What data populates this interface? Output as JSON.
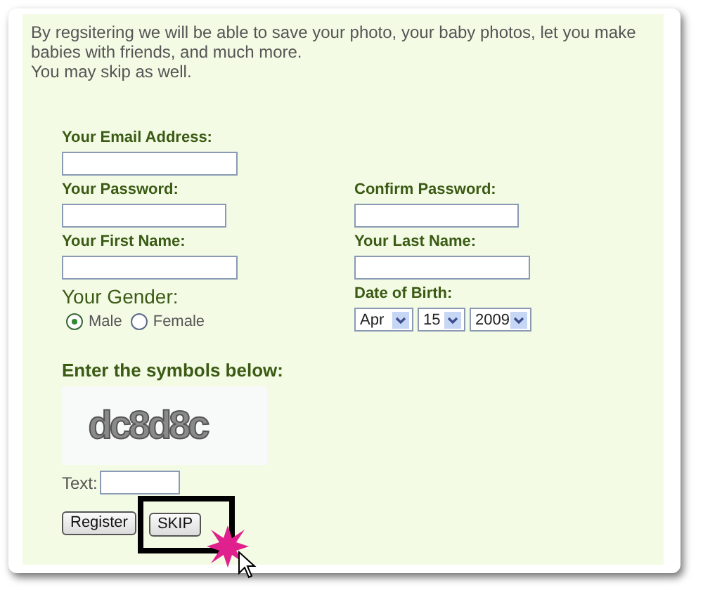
{
  "intro": [
    "By regsitering we will be able to save your photo, your baby photos, let you make babies with friends, and much more.",
    "You may skip as well."
  ],
  "email": {
    "label": "Your Email Address:"
  },
  "password": {
    "label": "Your Password:"
  },
  "confirm_password": {
    "label": "Confirm Password:"
  },
  "first_name": {
    "label": "Your First Name:"
  },
  "last_name": {
    "label": "Your Last Name:"
  },
  "gender": {
    "label": "Your Gender:",
    "options": [
      {
        "label": "Male",
        "selected": true
      },
      {
        "label": "Female",
        "selected": false
      }
    ]
  },
  "date_of_birth": {
    "label": "Date of Birth:",
    "month": "Apr",
    "day": "15",
    "year": "2009"
  },
  "captcha": {
    "label": "Enter the symbols below:",
    "symbols": "dc8d8c",
    "text_label": "Text:"
  },
  "buttons": [
    {
      "label": "Register",
      "highlighted": false
    },
    {
      "label": "SKIP",
      "highlighted": true
    }
  ]
}
